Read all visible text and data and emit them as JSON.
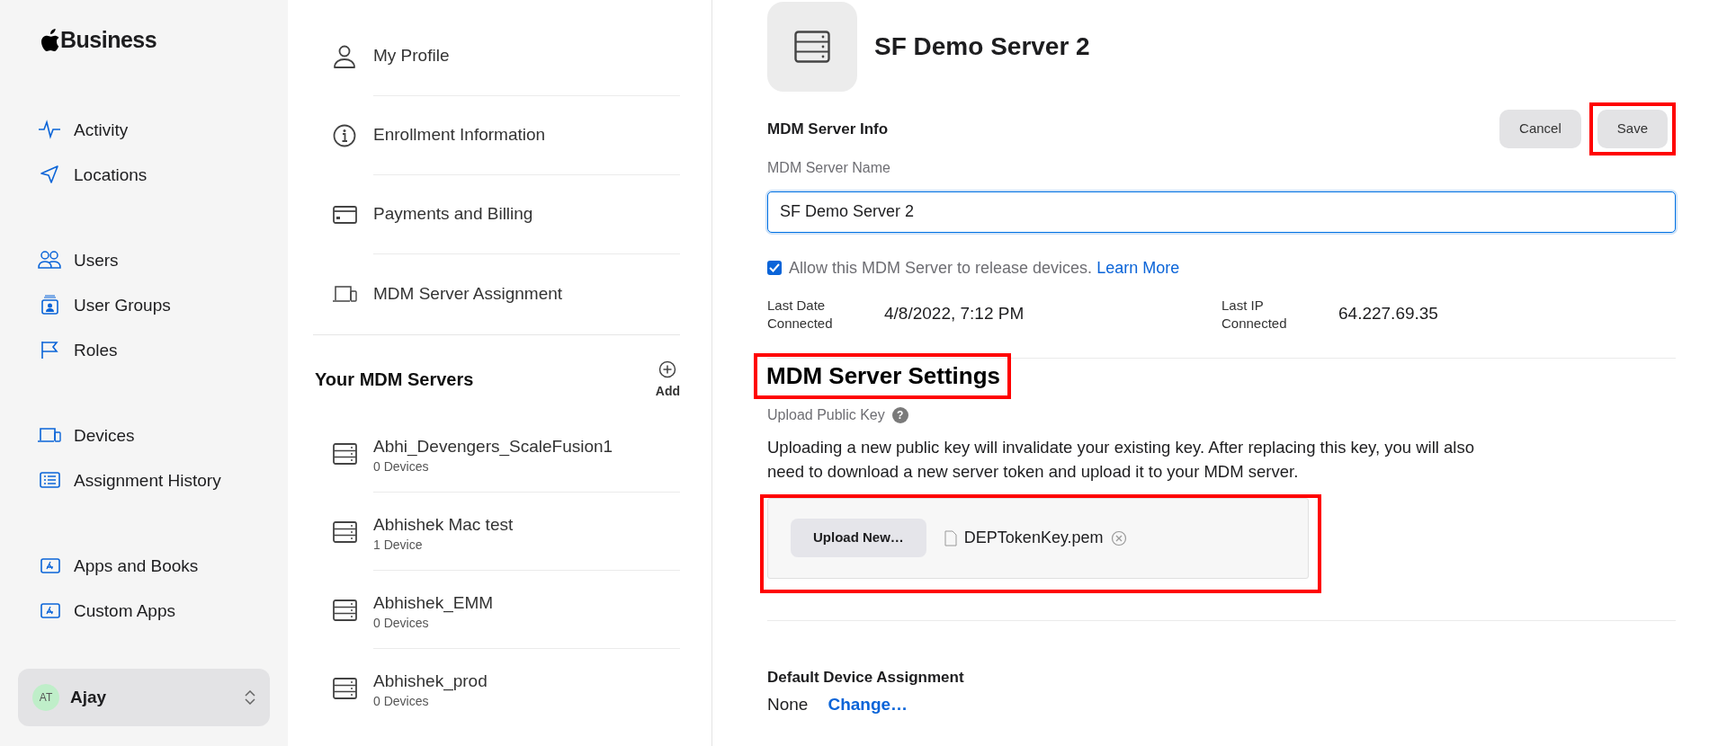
{
  "sidebar": {
    "logo": "Business",
    "groups": [
      {
        "items": [
          {
            "label": "Activity"
          },
          {
            "label": "Locations"
          }
        ]
      },
      {
        "items": [
          {
            "label": "Users"
          },
          {
            "label": "User Groups"
          },
          {
            "label": "Roles"
          }
        ]
      },
      {
        "items": [
          {
            "label": "Devices"
          },
          {
            "label": "Assignment History"
          }
        ]
      },
      {
        "items": [
          {
            "label": "Apps and Books"
          },
          {
            "label": "Custom Apps"
          }
        ]
      }
    ],
    "user": {
      "initials": "AT",
      "name": "Ajay"
    }
  },
  "menu": [
    {
      "label": "My Profile"
    },
    {
      "label": "Enrollment Information"
    },
    {
      "label": "Payments and Billing"
    },
    {
      "label": "MDM Server Assignment"
    }
  ],
  "servers_heading": "Your MDM Servers",
  "add_label": "Add",
  "servers": [
    {
      "name": "Abhi_Devengers_ScaleFusion1",
      "count": "0 Devices"
    },
    {
      "name": "Abhishek Mac test",
      "count": "1 Device"
    },
    {
      "name": "Abhishek_EMM",
      "count": "0 Devices"
    },
    {
      "name": "Abhishek_prod",
      "count": "0 Devices"
    }
  ],
  "detail": {
    "title": "SF Demo Server 2",
    "section": "MDM Server Info",
    "buttons": [
      {
        "label": "Cancel",
        "annotated": false
      },
      {
        "label": "Save",
        "annotated": true
      }
    ],
    "name_label": "MDM Server Name",
    "name_value": "SF Demo Server 2",
    "allow": {
      "checked": true,
      "text": "Allow this MDM Server to release devices.",
      "link": "Learn More"
    },
    "stats": [
      {
        "label": "Last Date Connected",
        "value": "4/8/2022, 7:12 PM"
      },
      {
        "label": "Last IP Connected",
        "value": "64.227.69.35"
      }
    ],
    "settings_heading": {
      "text": "MDM Server Settings",
      "annotated": true
    },
    "upload_label": "Upload Public Key",
    "upload_help": "?",
    "upload_note": "Uploading a new public key will invalidate your existing key. After replacing this key, you will also need to download a new server token and upload it to your MDM server.",
    "upload": {
      "button": "Upload New…",
      "file": "DEPTokenKey.pem",
      "annotated": true
    },
    "default_heading": "Default Device Assignment",
    "default_value": "None",
    "default_link": "Change…"
  }
}
